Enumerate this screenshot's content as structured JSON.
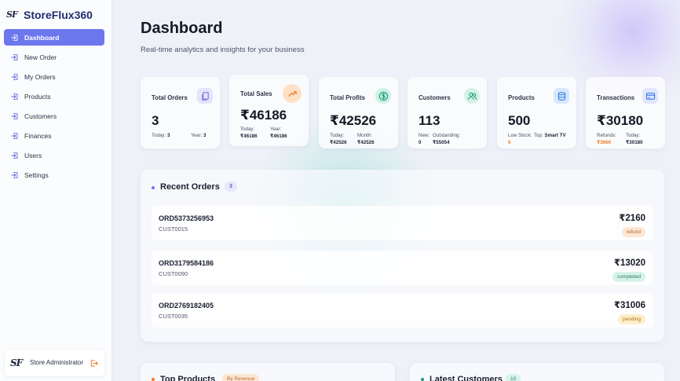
{
  "app": {
    "name": "StoreFlux360",
    "logo_text": "SF"
  },
  "sidebar": {
    "items": [
      {
        "label": "Dashboard",
        "icon": "login-arrow-icon",
        "active": true
      },
      {
        "label": "New Order",
        "icon": "login-arrow-icon",
        "active": false
      },
      {
        "label": "My Orders",
        "icon": "login-arrow-icon",
        "active": false
      },
      {
        "label": "Products",
        "icon": "login-arrow-icon",
        "active": false
      },
      {
        "label": "Customers",
        "icon": "login-arrow-icon",
        "active": false
      },
      {
        "label": "Finances",
        "icon": "login-arrow-icon",
        "active": false
      },
      {
        "label": "Users",
        "icon": "login-arrow-icon",
        "active": false
      },
      {
        "label": "Settings",
        "icon": "login-arrow-icon",
        "active": false
      }
    ],
    "user": {
      "name": "Store Administrator",
      "logout_icon": "logout-icon"
    }
  },
  "header": {
    "title": "Dashboard",
    "subtitle": "Real-time analytics and insights for your business"
  },
  "stats": {
    "total_orders": {
      "label": "Total Orders",
      "value": "3",
      "sub1_label": "Today:",
      "sub1_value": "3",
      "sub2_label": "Year:",
      "sub2_value": "3",
      "icon": "copy-icon"
    },
    "total_sales": {
      "label": "Total Sales",
      "value": "₹46186",
      "sub1_label": "Today:",
      "sub1_value": "₹46186",
      "sub2_label": "Year:",
      "sub2_value": "₹46186",
      "icon": "trend-up-icon"
    },
    "total_profits": {
      "label": "Total Profits",
      "value": "₹42526",
      "sub1_label": "Today:",
      "sub1_value": "₹42526",
      "sub2_label": "Month:",
      "sub2_value": "₹42526",
      "icon": "dollar-circle-icon"
    },
    "customers": {
      "label": "Customers",
      "value": "113",
      "sub1_label": "New:",
      "sub1_value": "0",
      "sub2_label": "Outstanding:",
      "sub2_value": "₹55054",
      "icon": "users-icon"
    },
    "products": {
      "label": "Products",
      "value": "500",
      "sub1_label": "Low Stock:",
      "sub1_value": "0",
      "sub2_label": "Top:",
      "sub2_value": "Smart TV",
      "icon": "database-icon"
    },
    "transactions": {
      "label": "Transactions",
      "value": "₹30180",
      "sub1_label": "Refunds:",
      "sub1_value": "₹3660",
      "sub2_label": "Today:",
      "sub2_value": "₹30180",
      "icon": "credit-card-icon"
    }
  },
  "recent_orders": {
    "title": "Recent Orders",
    "count": "3",
    "rows": [
      {
        "id": "ORD5373256953",
        "customer": "CUST0015",
        "amount": "₹2160",
        "status": "refund"
      },
      {
        "id": "ORD3179584186",
        "customer": "CUST0090",
        "amount": "₹13020",
        "status": "completed"
      },
      {
        "id": "ORD2769182405",
        "customer": "CUST0035",
        "amount": "₹31006",
        "status": "pending"
      }
    ]
  },
  "bottom": {
    "top_products": {
      "title": "Top Products",
      "badge": "By Revenue"
    },
    "latest_customers": {
      "title": "Latest Customers",
      "count": "10"
    }
  },
  "colors": {
    "accent": "#6c77ee",
    "orders_icon_bg": "#e6e3fb",
    "sales_icon_bg": "#fde0c6",
    "profits_icon_bg": "#cdf1e5",
    "customers_icon_bg": "#d4f2e8",
    "products_icon_bg": "#d6e8fd",
    "transactions_icon_bg": "#dfe6fd"
  }
}
